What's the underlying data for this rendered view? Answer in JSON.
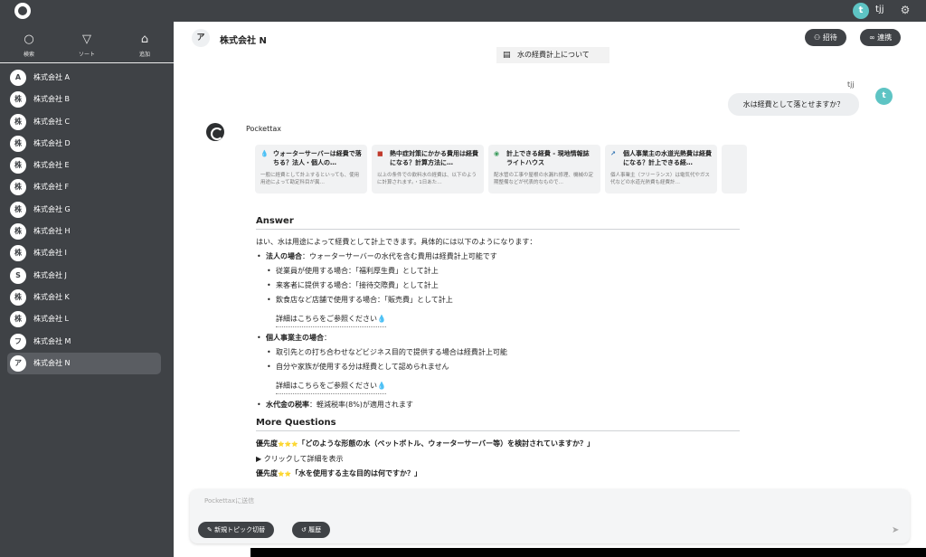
{
  "topbar": {
    "avatar_letter": "t",
    "user": "tjj",
    "gear": "⚙"
  },
  "sidebar": {
    "tools": [
      {
        "icon": "search-icon",
        "glyph": "○",
        "label": "検索"
      },
      {
        "icon": "filter-icon",
        "glyph": "▽",
        "label": "ソート"
      },
      {
        "icon": "add-home-icon",
        "glyph": "⌂",
        "label": "追加"
      }
    ],
    "items": [
      {
        "badge": "A",
        "name": "株式会社 A"
      },
      {
        "badge": "株",
        "name": "株式会社 B"
      },
      {
        "badge": "株",
        "name": "株式会社 C"
      },
      {
        "badge": "株",
        "name": "株式会社 D"
      },
      {
        "badge": "株",
        "name": "株式会社 E"
      },
      {
        "badge": "株",
        "name": "株式会社 F"
      },
      {
        "badge": "株",
        "name": "株式会社 G"
      },
      {
        "badge": "株",
        "name": "株式会社 H"
      },
      {
        "badge": "株",
        "name": "株式会社 I"
      },
      {
        "badge": "S",
        "name": "株式会社 J"
      },
      {
        "badge": "株",
        "name": "株式会社 K"
      },
      {
        "badge": "株",
        "name": "株式会社 L"
      },
      {
        "badge": "フ",
        "name": "株式会社 M"
      },
      {
        "badge": "ア",
        "name": "株式会社 N"
      }
    ]
  },
  "header": {
    "avatar": "ア",
    "title": "株式会社 N",
    "invite": "招待",
    "link": "連携"
  },
  "topic": "水の経費計上について",
  "user_msg": {
    "name": "tjj",
    "text": "水は経費として落とせますか？",
    "avatar": "t"
  },
  "bot": {
    "name": "Pockettax"
  },
  "sources": [
    {
      "title": "ウォーターサーバーは経費で落ちる？法人・個人の…",
      "snippet": "一般に経費として計上するといっても、使用用途によって勘定科目が異…",
      "icon": "💧"
    },
    {
      "title": "熱中症対策にかかる費用は経費になる？計算方法に…",
      "snippet": "以上の条件での飲料水の経費は、以下のように計算されます。・1日あた…",
      "icon": "■"
    },
    {
      "title": "計上できる経費 - 現地情報誌ライトハウス",
      "snippet": "配水管の工事や屋根の水漏れ修理、機械の定期整備などが代表的なもので…",
      "icon": "◉"
    },
    {
      "title": "個人事業主の水道光熱費は経費になる？計上できる経…",
      "snippet": "個人事業主（フリーランス）は電気代やガス代などの水道光熱費も経費計…",
      "icon": "↗"
    }
  ],
  "answer": {
    "heading": "Answer",
    "intro": "はい、水は用途によって経費として計上できます。具体的には以下のようになります：",
    "corp_title": "法人の場合",
    "corp_text": "：ウォーターサーバーの水代を含む費用は経費計上可能です",
    "corp_items": [
      "従業員が使用する場合：「福利厚生費」として計上",
      "来客者に提供する場合：「接待交際費」として計上",
      "飲食店など店舗で使用する場合：「販売費」として計上"
    ],
    "ref1": "詳細はこちらをご参照ください💧",
    "indiv_title": "個人事業主の場合",
    "indiv_colon": "：",
    "indiv_items": [
      "取引先との打ち合わせなどビジネス目的で提供する場合は経費計上可能",
      "自分や家族が使用する分は経費として認められません"
    ],
    "ref2": "詳細はこちらをご参照ください💧",
    "tax_title": "水代金の税率",
    "tax_text": "：軽減税率(8%)が適用されます"
  },
  "more": {
    "heading": "More Questions",
    "q1_prefix": "優先度",
    "q1_stars": "⭐⭐⭐",
    "q1_text": "「どのような形態の水（ペットボトル、ウォーターサーバー等）を検討されていますか？」",
    "q1_toggle": "▶ クリックして詳細を表示",
    "q2_prefix": "優先度",
    "q2_stars": "⭐⭐",
    "q2_text": "「水を使用する主な目的は何ですか？」"
  },
  "input": {
    "placeholder": "Pockettaxに送信",
    "new_topic": "新規トピック切替",
    "history": "履歴"
  }
}
